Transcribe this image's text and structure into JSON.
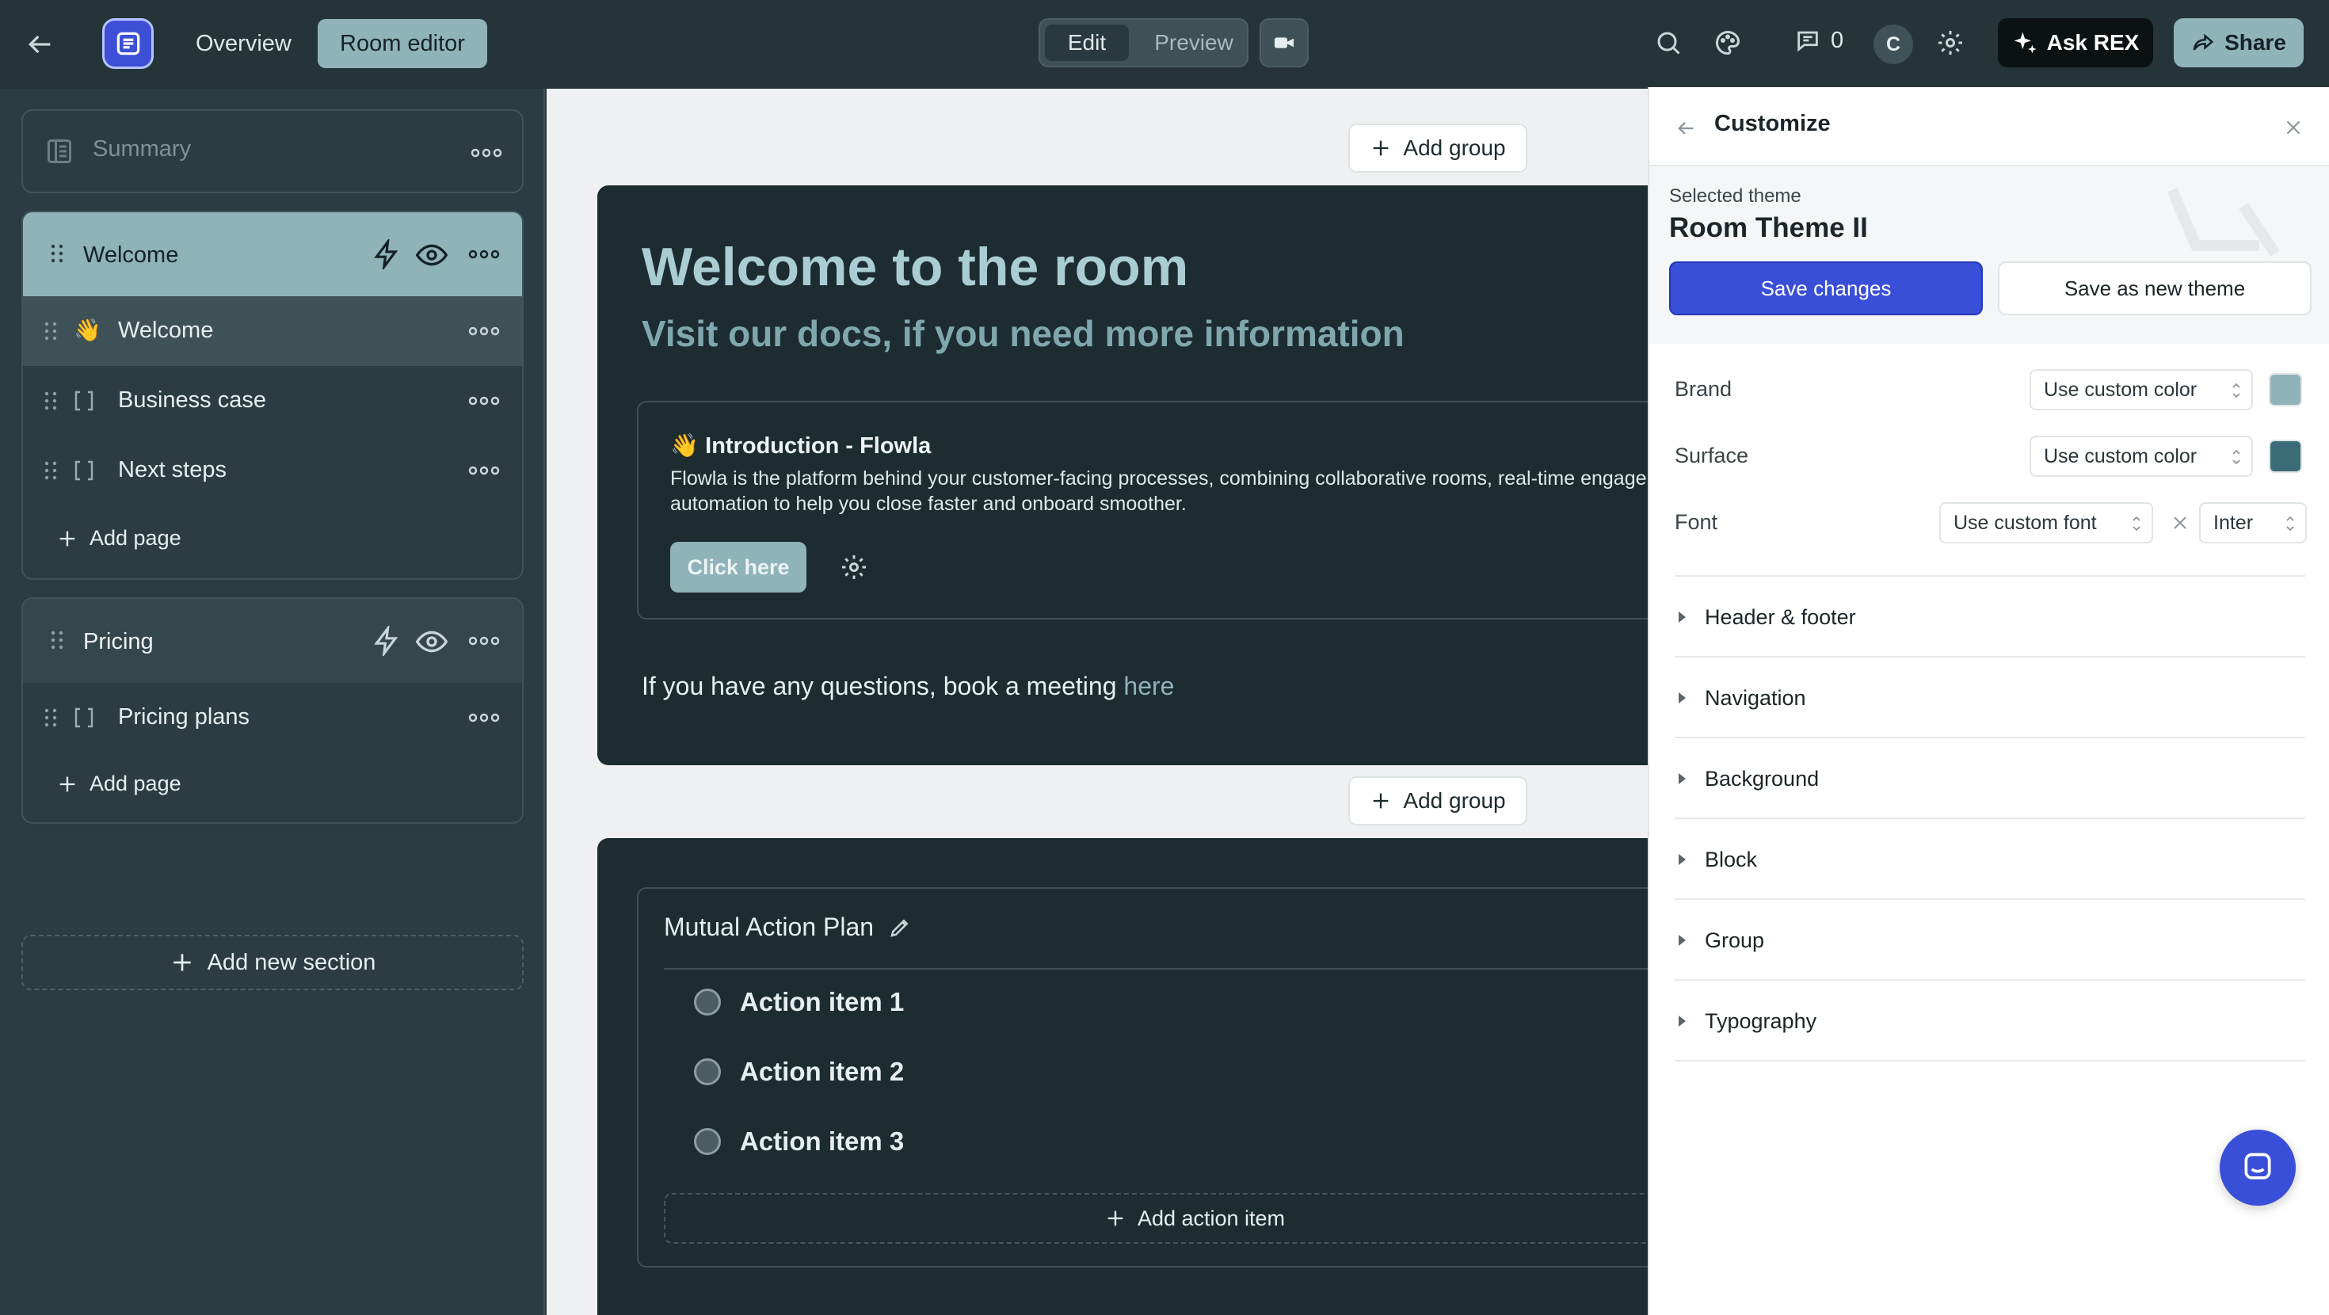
{
  "topbar": {
    "tabs": [
      {
        "label": "Overview",
        "active": false
      },
      {
        "label": "Room editor",
        "active": true
      }
    ],
    "mode": {
      "edit_label": "Edit",
      "preview_label": "Preview",
      "active": "Edit"
    },
    "comment_count": "0",
    "user_initial": "C",
    "ask_rex_label": "Ask REX",
    "share_label": "Share"
  },
  "sidebar": {
    "summary_label": "Summary",
    "sections": [
      {
        "title": "Welcome",
        "pages": [
          {
            "emoji": "👋",
            "label": "Welcome"
          },
          {
            "label": "Business case"
          },
          {
            "label": "Next steps"
          }
        ],
        "add_page_label": "Add page"
      },
      {
        "title": "Pricing",
        "pages": [
          {
            "label": "Pricing plans"
          }
        ],
        "add_page_label": "Add page"
      }
    ],
    "add_section_label": "Add new section"
  },
  "canvas": {
    "add_group_label": "Add group",
    "welcome": {
      "title": "Welcome to the room",
      "subtitle": "Visit our docs, if you need more information",
      "intro_title": "👋 Introduction - Flowla",
      "intro_text": "Flowla is the platform behind your customer-facing processes, combining collaborative rooms, real-time engagement and automation to help you close faster and onboard smoother.",
      "button_label": "Click here",
      "questions_text": "If you have any questions, book a meeting ",
      "questions_link": "here"
    },
    "action_plan": {
      "title": "Mutual Action Plan",
      "items": [
        "Action item 1",
        "Action item 2",
        "Action item 3"
      ],
      "add_label": "Add action item"
    }
  },
  "customize": {
    "title": "Customize",
    "selected_theme_label": "Selected theme",
    "theme_name": "Room Theme II",
    "save_label": "Save changes",
    "save_new_label": "Save as new theme",
    "properties": {
      "brand": {
        "label": "Brand",
        "value": "Use custom color",
        "color": "#8fb3b8"
      },
      "surface": {
        "label": "Surface",
        "value": "Use custom color",
        "color": "#3b6d78"
      },
      "font": {
        "label": "Font",
        "value": "Use custom font",
        "font_value": "Inter"
      }
    },
    "sections": [
      "Header & footer",
      "Navigation",
      "Background",
      "Block",
      "Group",
      "Typography"
    ]
  },
  "colors": {
    "brand": "#8fb3b8",
    "accent_blue": "#3a4fd8",
    "sidebar_bg": "#2b3d42",
    "panel_bg": "#1d2c31"
  }
}
